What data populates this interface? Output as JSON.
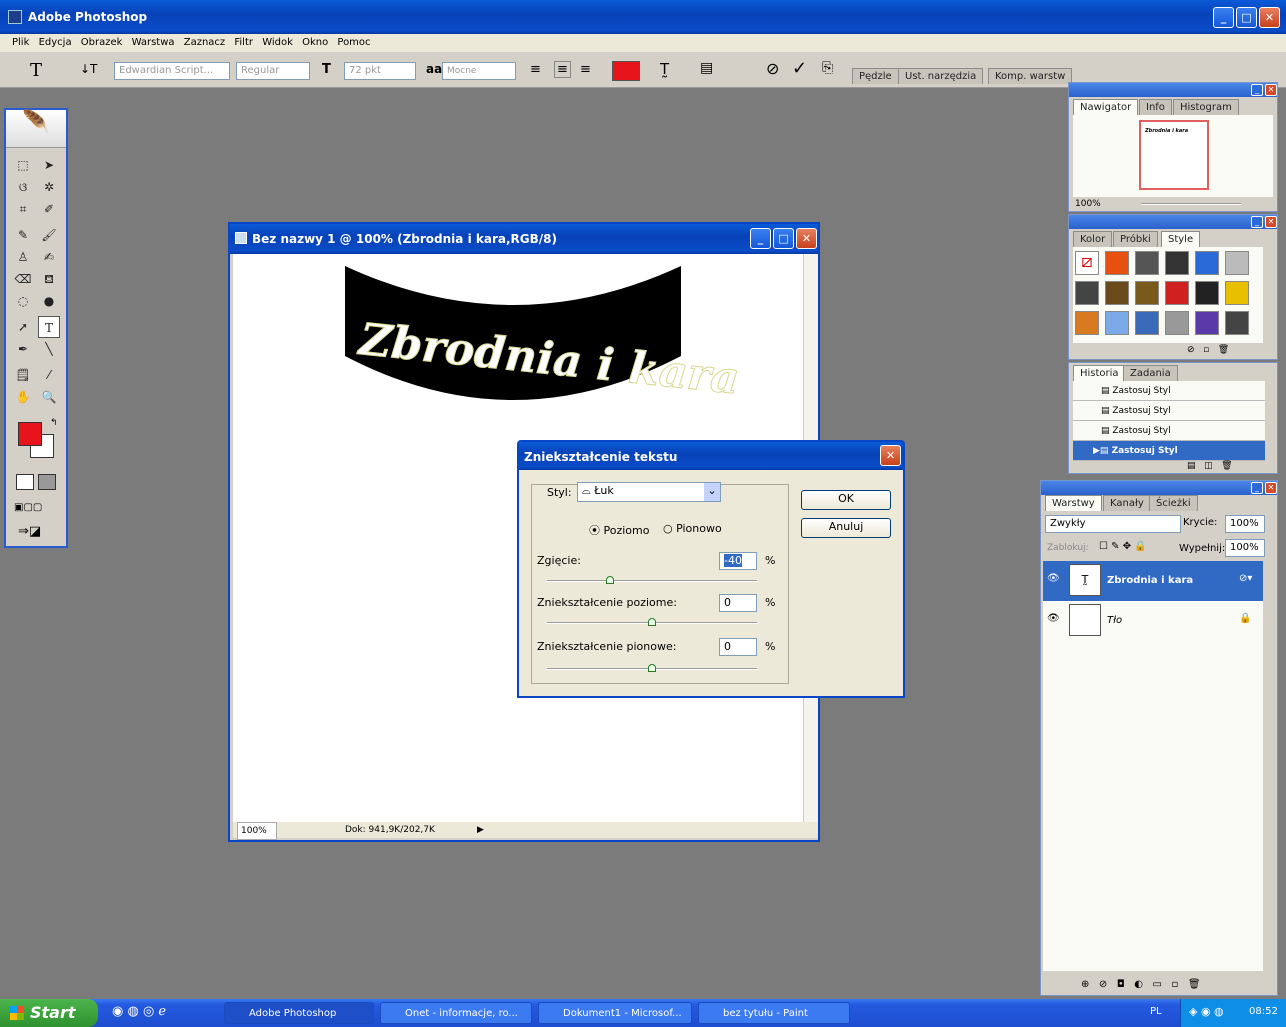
{
  "app": {
    "title": "Adobe Photoshop"
  },
  "menu": [
    "Plik",
    "Edycja",
    "Obrazek",
    "Warstwa",
    "Zaznacz",
    "Filtr",
    "Widok",
    "Okno",
    "Pomoc"
  ],
  "options": {
    "font": "Edwardian Script...",
    "style": "Regular",
    "size": "72 pkt",
    "aa": "Mocne",
    "color": "#e8141c",
    "tabs": [
      "Pędzle",
      "Ust. narzędzia",
      "Komp. warstw"
    ]
  },
  "document": {
    "title": "Bez nazwy 1 @ 100% (Zbrodnia i kara,RGB/8)",
    "text": "Zbrodnia i kara",
    "zoom": "100%",
    "doc_info": "Dok: 941,9K/202,7K"
  },
  "navigator": {
    "tabs": [
      "Nawigator",
      "Info",
      "Histogram"
    ],
    "zoom": "100%",
    "thumb_text": "Zbrodnia i kara"
  },
  "styles": {
    "tabs": [
      "Kolor",
      "Próbki",
      "Style"
    ]
  },
  "history": {
    "tabs": [
      "Historia",
      "Zadania"
    ],
    "items": [
      "Zastosuj Styl",
      "Zastosuj Styl",
      "Zastosuj Styl",
      "Zastosuj Styl"
    ]
  },
  "layers": {
    "tabs": [
      "Warstwy",
      "Kanały",
      "Ścieżki"
    ],
    "blend": "Zwykły",
    "opacity_label": "Krycie:",
    "opacity": "100%",
    "lock_label": "Zablokuj:",
    "fill_label": "Wypełnij:",
    "fill": "100%",
    "items": [
      {
        "name": "Zbrodnia i kara"
      },
      {
        "name": "Tło"
      }
    ]
  },
  "dialog": {
    "title": "Zniekształcenie tekstu",
    "style_label": "Styl:",
    "style_value": "Łuk",
    "horizontal": "Poziomo",
    "vertical": "Pionowo",
    "bend_label": "Zgięcie:",
    "bend": "-40",
    "hdist_label": "Zniekształcenie poziome:",
    "hdist": "0",
    "vdist_label": "Zniekształcenie pionowe:",
    "vdist": "0",
    "percent": "%",
    "ok": "OK",
    "cancel": "Anuluj",
    "bend_level": 0.3,
    "hdist_level": 0.5,
    "vdist_level": 0.5
  },
  "taskbar": {
    "start": "Start",
    "tasks": [
      "Adobe Photoshop",
      "Onet - informacje, ro...",
      "Dokument1 - Microsof...",
      "bez tytułu - Paint"
    ],
    "lang": "PL",
    "time": "08:52"
  }
}
